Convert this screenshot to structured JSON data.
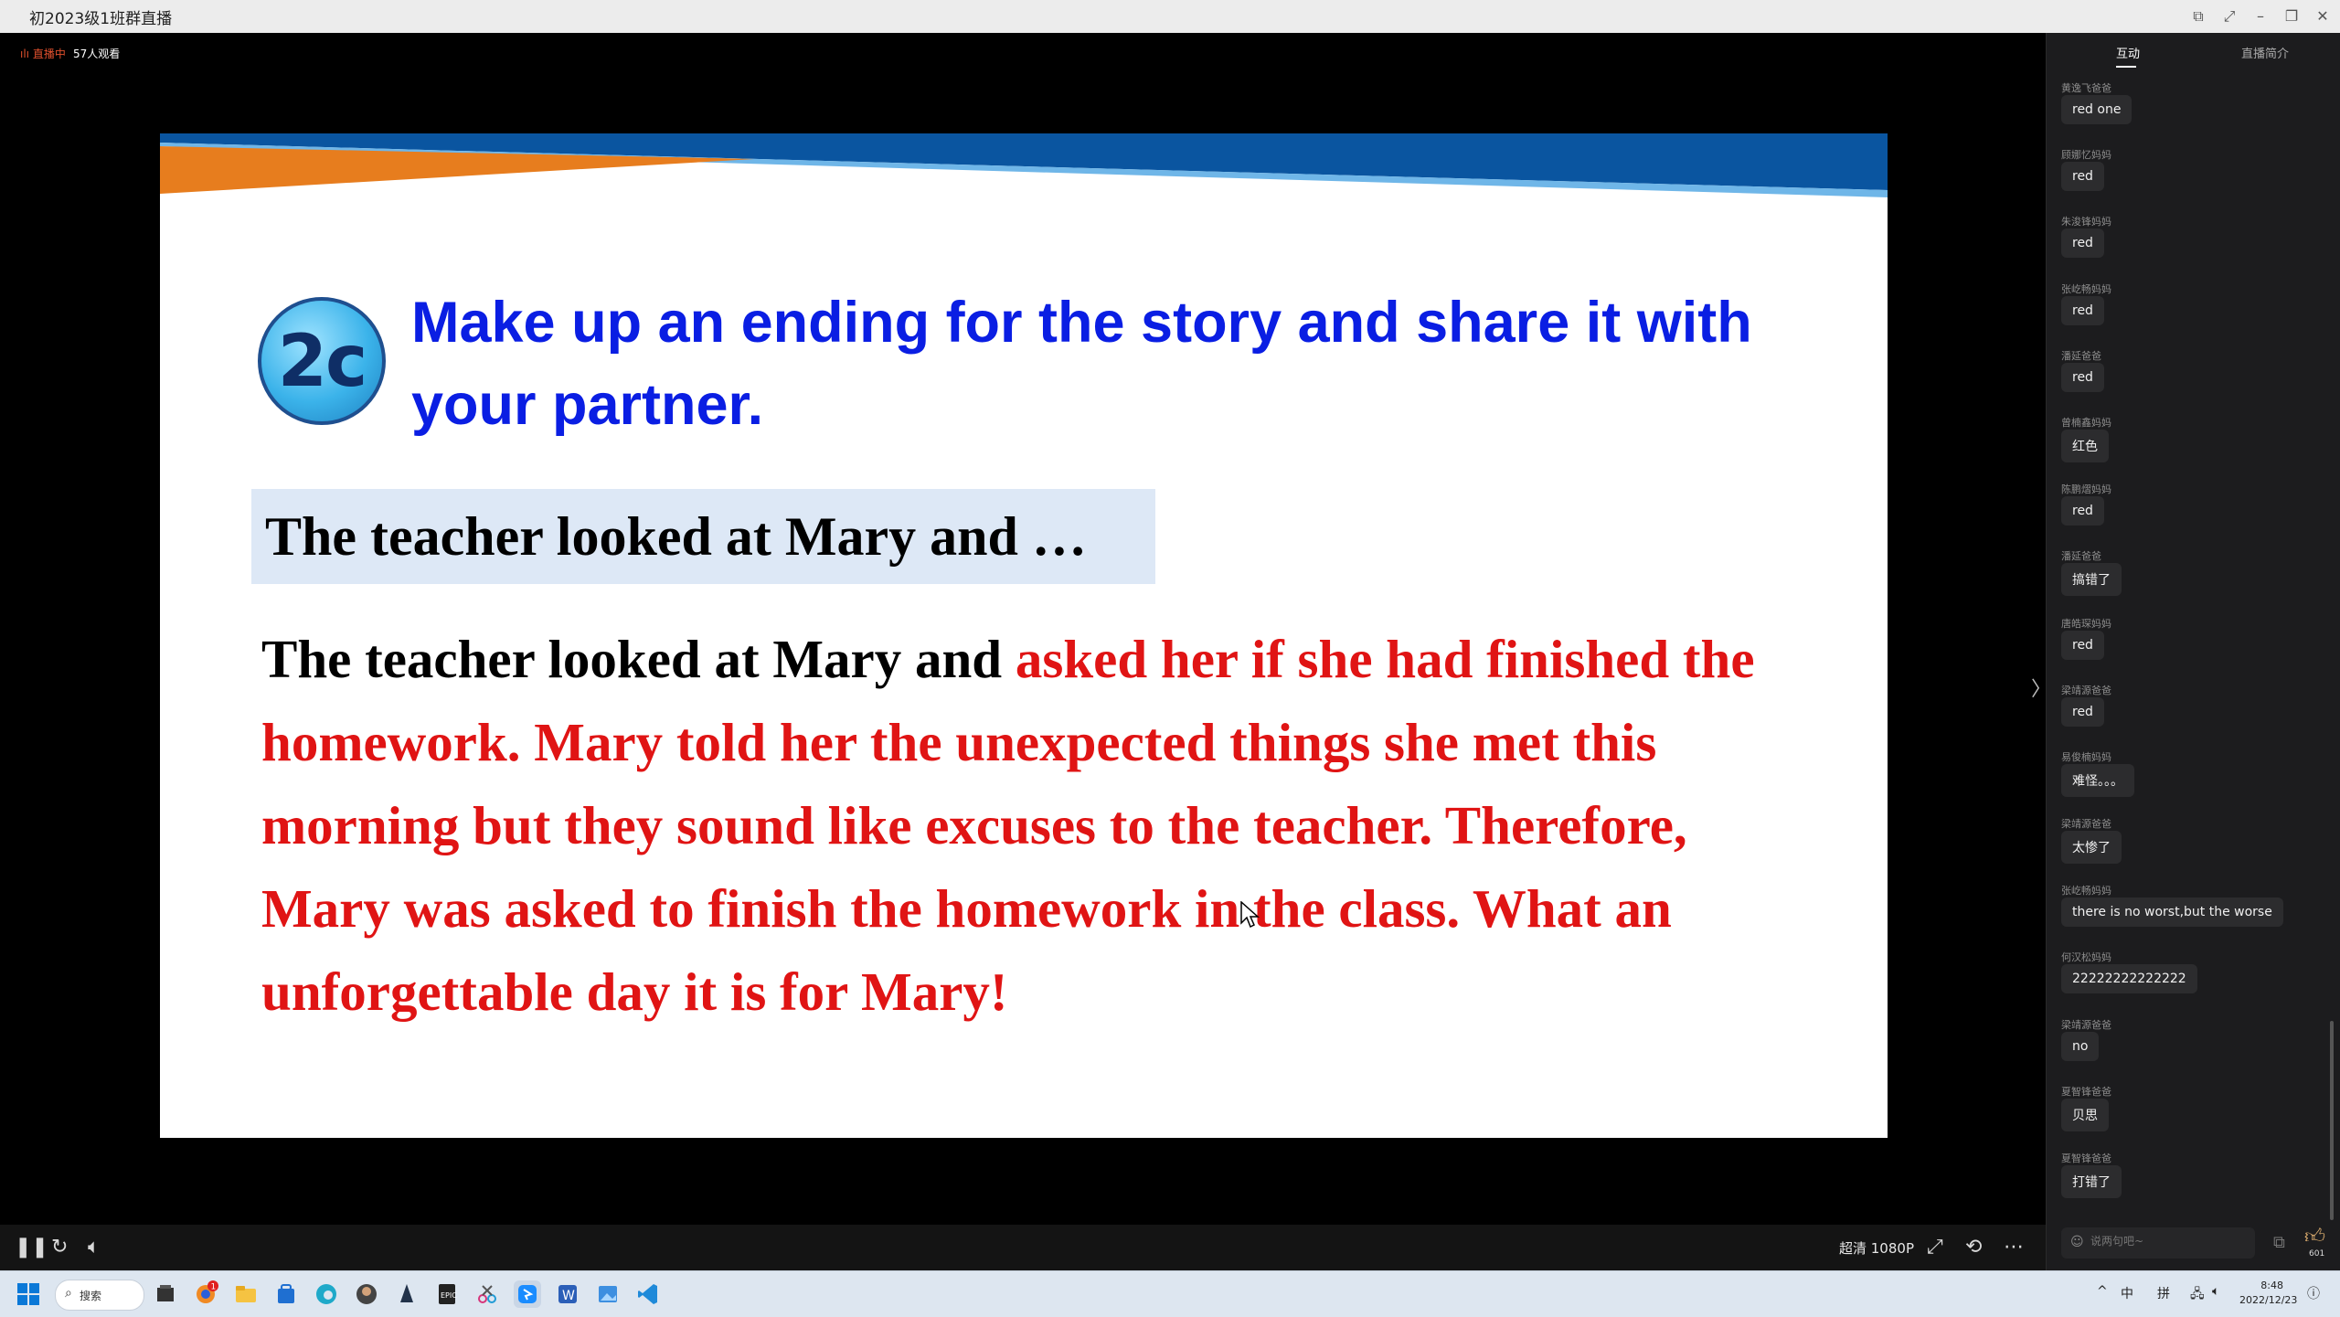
{
  "window": {
    "title": "初2023级1班群直播",
    "controls": [
      "pin-icon",
      "fullscreen-icon",
      "minimize-icon",
      "restore-icon",
      "close-icon"
    ]
  },
  "live": {
    "status": "直播中",
    "viewers": "57人观看"
  },
  "slide": {
    "badge": "2c",
    "heading": "Make up an ending for the story and share it with your partner.",
    "prompt": "The teacher looked at Mary and …",
    "story_black": "The teacher looked at Mary and ",
    "story_red": "asked her if she had finished the homework. Mary told her the unexpected things she met this morning but they sound like excuses to the teacher. Therefore, Mary was asked to finish the homework in the class. What an unforgettable day it is for Mary!",
    "colors": {
      "heading": "#0a1ee3",
      "story_red": "#e01414",
      "prompt_bg": "#dde8f6"
    }
  },
  "player_controls": {
    "quality": "超清 1080P",
    "icons": [
      "pause-icon",
      "refresh-icon",
      "volume-icon",
      "fullscreen-icon",
      "rotate-icon",
      "more-icon"
    ]
  },
  "sidebar": {
    "tabs": [
      "互动",
      "直播简介"
    ],
    "active_tab": "互动",
    "messages": [
      {
        "user": "黄逸飞爸爸",
        "text": "red one"
      },
      {
        "user": "顾娜忆妈妈",
        "text": "red"
      },
      {
        "user": "朱浚锋妈妈",
        "text": "red"
      },
      {
        "user": "张屹畅妈妈",
        "text": "red"
      },
      {
        "user": "潘延爸爸",
        "text": "red"
      },
      {
        "user": "曾楠鑫妈妈",
        "text": "红色"
      },
      {
        "user": "陈鹏熠妈妈",
        "text": "red"
      },
      {
        "user": "潘延爸爸",
        "text": "搞错了"
      },
      {
        "user": "唐皓琛妈妈",
        "text": "red"
      },
      {
        "user": "梁靖源爸爸",
        "text": "red"
      },
      {
        "user": "易俊楠妈妈",
        "text": "难怪。。。"
      },
      {
        "user": "梁靖源爸爸",
        "text": "太惨了"
      },
      {
        "user": "张屹畅妈妈",
        "text": "there is no worst,but the worse"
      },
      {
        "user": "何汉松妈妈",
        "text": "22222222222222"
      },
      {
        "user": "梁靖源爸爸",
        "text": "no"
      },
      {
        "user": "夏智锋爸爸",
        "text": "贝思"
      },
      {
        "user": "夏智锋爸爸",
        "text": "打错了"
      }
    ],
    "input_placeholder": "说两句吧~",
    "like_count": "601"
  },
  "taskbar": {
    "search_label": "搜索",
    "notification_count": "1",
    "apps": [
      "start-icon",
      "search-pill",
      "file-explorer-icon",
      "browser-icon",
      "folder-icon",
      "store-icon",
      "edge-icon",
      "app-icon",
      "app-icon-2",
      "epic-icon",
      "snip-icon",
      "dingtalk-icon",
      "word-icon",
      "photos-icon",
      "vscode-icon"
    ],
    "tray": {
      "chevron": "^",
      "ime1": "中",
      "ime2": "拼"
    },
    "time": "8:48",
    "date": "2022/12/23"
  }
}
